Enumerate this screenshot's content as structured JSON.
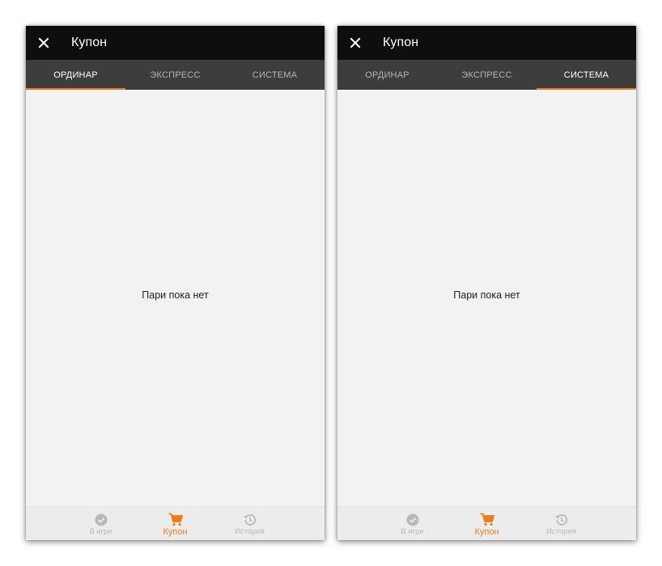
{
  "colors": {
    "accent": "#f07b1a",
    "app_bar": "#0e0e0e",
    "tab_bar": "#3d3d3d",
    "content_bg": "#f2f2f2",
    "inactive": "#b8b8b8"
  },
  "screens": [
    {
      "app_bar": {
        "close_icon": "close-icon",
        "title": "Купон"
      },
      "tabs": [
        {
          "label": "ОРДИНАР",
          "active": true
        },
        {
          "label": "ЭКСПРЕСС",
          "active": false
        },
        {
          "label": "СИСТЕМА",
          "active": false
        }
      ],
      "empty_message": "Пари пока нет",
      "bottom_nav": [
        {
          "label": "В игре",
          "icon": "check-circle-icon",
          "active": false
        },
        {
          "label": "Купон",
          "icon": "cart-icon",
          "active": true
        },
        {
          "label": "История",
          "icon": "history-icon",
          "active": false
        }
      ]
    },
    {
      "app_bar": {
        "close_icon": "close-icon",
        "title": "Купон"
      },
      "tabs": [
        {
          "label": "ОРДИНАР",
          "active": false
        },
        {
          "label": "ЭКСПРЕСС",
          "active": false
        },
        {
          "label": "СИСТЕМА",
          "active": true
        }
      ],
      "empty_message": "Пари пока нет",
      "bottom_nav": [
        {
          "label": "В игре",
          "icon": "check-circle-icon",
          "active": false
        },
        {
          "label": "Купон",
          "icon": "cart-icon",
          "active": true
        },
        {
          "label": "История",
          "icon": "history-icon",
          "active": false
        }
      ]
    }
  ]
}
